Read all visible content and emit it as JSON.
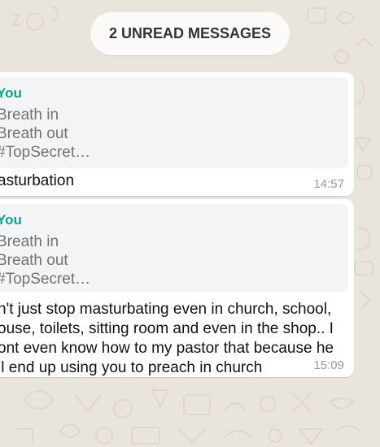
{
  "chat": {
    "unread_banner": "2 UNREAD MESSAGES",
    "messages": [
      {
        "quote": {
          "author": "You",
          "lines": [
            "Breath in",
            "Breath out",
            "#TopSecret…"
          ]
        },
        "text_lines": [
          "asturbation"
        ],
        "time": "14:57"
      },
      {
        "quote": {
          "author": "You",
          "lines": [
            "Breath in",
            "Breath out",
            "#TopSecret…"
          ]
        },
        "text_lines": [
          "n't just stop masturbating even in church, school,",
          "ouse, toilets, sitting room and even in the shop.. I",
          "ont even know how to my pastor that because he",
          "ll end up using you to preach in church"
        ],
        "time": "15:09"
      }
    ]
  },
  "colors": {
    "wallpaper": "#e9e4dc",
    "bubble": "#ffffff",
    "quote_bg": "#f3f4f5",
    "quote_author": "#12a08d",
    "quote_text": "#737373",
    "time": "#999999"
  }
}
